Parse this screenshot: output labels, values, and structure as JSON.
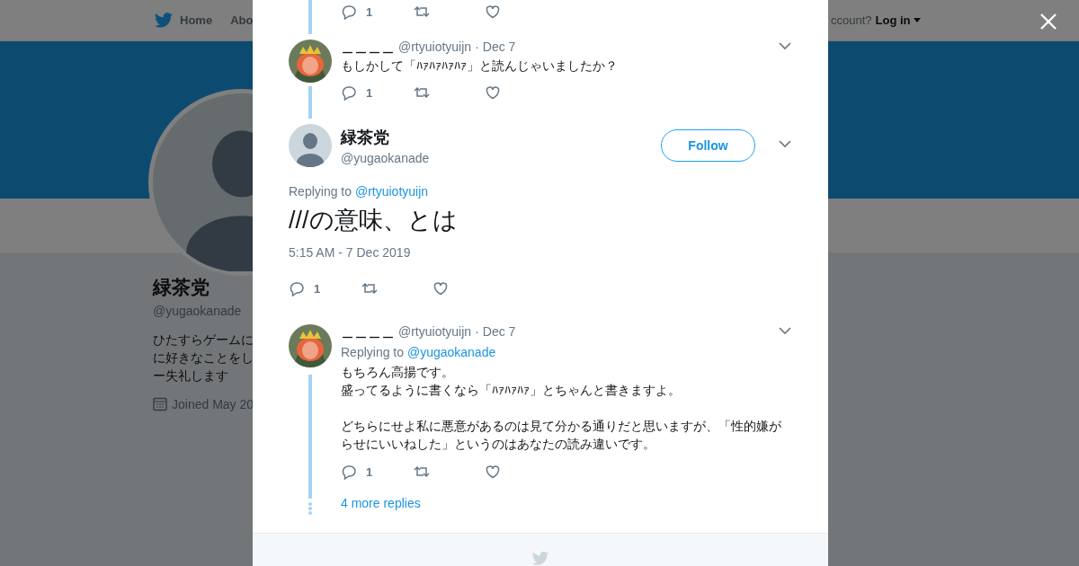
{
  "nav": {
    "items": [
      {
        "label": "Home"
      },
      {
        "label": "Abo"
      }
    ],
    "account_prompt": "ccount?",
    "login": "Log in"
  },
  "profile": {
    "name": "緑茶党",
    "handle": "@yugaokanade",
    "bio": [
      "ひたすらゲームに",
      "に好きなことをし",
      "ー失礼します"
    ],
    "joined": "Joined May 20"
  },
  "thread": {
    "previous_actions": {
      "replies": "1"
    },
    "earlier": {
      "name": "＿＿＿＿",
      "handle": "@rtyuiotyuijn",
      "separator": "·",
      "date": "Dec 7",
      "text": "もしかして「ﾊｧﾊｧﾊｧﾊｧ」と読んじゃいましたか？",
      "replies": "1"
    },
    "main": {
      "name": "緑茶党",
      "handle": "@yugaokanade",
      "follow": "Follow",
      "replying_label": "Replying to",
      "replying_to": "@rtyuiotyuijn",
      "text": "///の意味、とは",
      "timestamp": "5:15 AM - 7 Dec 2019",
      "replies": "1"
    },
    "reply": {
      "name": "＿＿＿＿",
      "handle": "@rtyuiotyuijn",
      "separator": "·",
      "date": "Dec 7",
      "replying_label": "Replying to",
      "replying_to": "@yugaokanade",
      "text": [
        "もちろん高揚です。",
        "盛ってるように書くなら「ﾊｧﾊｧﾊｧ」とちゃんと書きますよ。",
        "どちらにせよ私に悪意があるのは見て分かる通りだと思いますが、「性的嫌がらせにいいねした」というのはあなたの読み違いです。"
      ],
      "replies": "1"
    },
    "more_replies": "4 more replies"
  }
}
